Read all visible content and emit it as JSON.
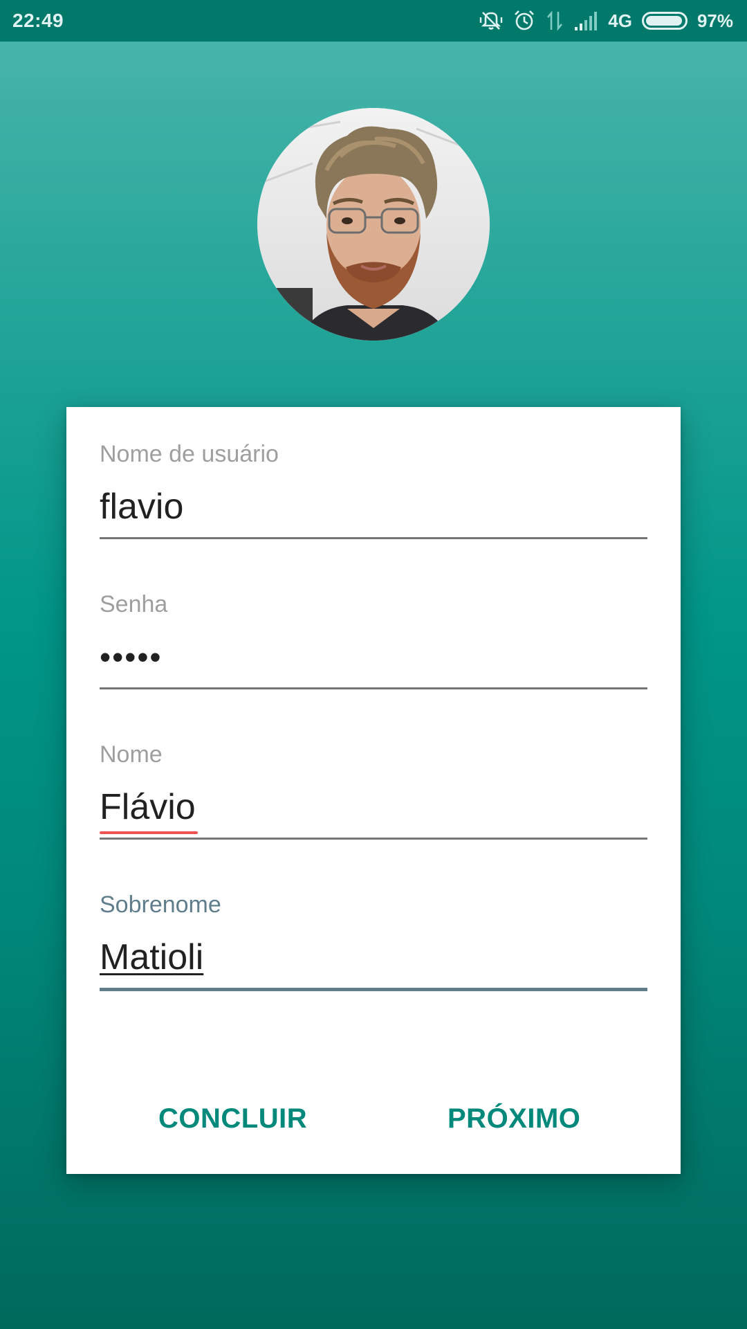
{
  "status_bar": {
    "time": "22:49",
    "network": "4G",
    "battery_percent": "97%",
    "battery_level": 0.97,
    "icons": [
      "vibrate-off-icon",
      "alarm-icon",
      "data-transfer-icon",
      "signal-icon",
      "battery-icon"
    ]
  },
  "profile": {
    "avatar_icon": "profile-photo"
  },
  "form": {
    "username": {
      "label": "Nome de usuário",
      "value": "flavio"
    },
    "password": {
      "label": "Senha",
      "value": "•••••"
    },
    "first_name": {
      "label": "Nome",
      "value": "Flávio"
    },
    "last_name": {
      "label": "Sobrenome",
      "value": "Matioli"
    }
  },
  "actions": {
    "finish_label": "CONCLUIR",
    "next_label": "PRÓXIMO"
  },
  "colors": {
    "accent": "#00897b",
    "status_bar": "#00796b",
    "focused_field": "#607d8b",
    "spell_error": "#ef5350"
  }
}
